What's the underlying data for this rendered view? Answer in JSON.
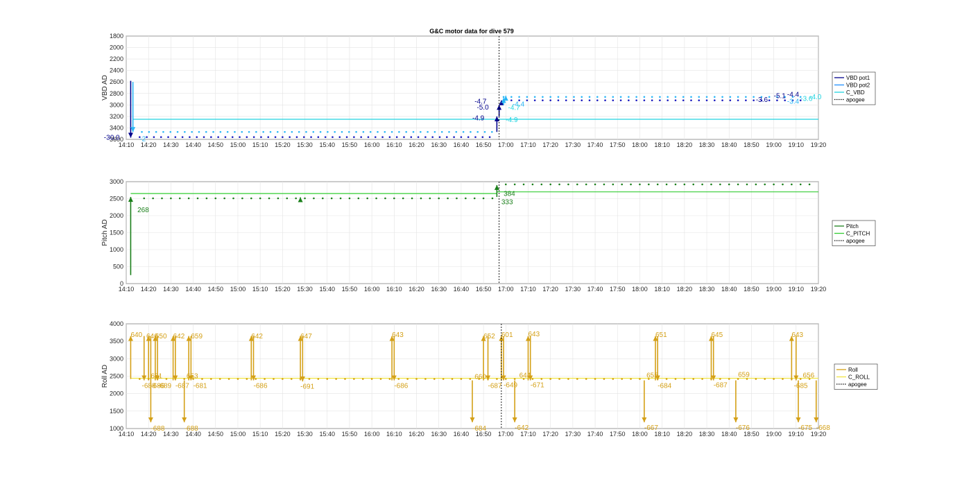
{
  "title": "G&C motor data for dive 579",
  "time_ticks": [
    "14:10",
    "14:20",
    "14:30",
    "14:40",
    "14:50",
    "15:00",
    "15:10",
    "15:20",
    "15:30",
    "15:40",
    "15:50",
    "16:00",
    "16:10",
    "16:20",
    "16:30",
    "16:40",
    "16:50",
    "17:00",
    "17:10",
    "17:20",
    "17:30",
    "17:40",
    "17:50",
    "18:00",
    "18:10",
    "18:20",
    "18:30",
    "18:40",
    "18:50",
    "19:00",
    "19:10",
    "19:20"
  ],
  "chart_data": [
    {
      "type": "scatter",
      "name": "vbd",
      "ylabel": "VBD AD",
      "xlim": [
        0,
        310
      ],
      "ylim": [
        3600,
        1800
      ],
      "y_reversed": true,
      "yticks": [
        1800,
        2000,
        2200,
        2400,
        2600,
        2800,
        3000,
        3200,
        3400,
        3600
      ],
      "apogee_x": 167,
      "legend": {
        "placement": "right",
        "entries": [
          {
            "label": "VBD pot1",
            "color": "#00008b",
            "style": "line"
          },
          {
            "label": "VBD pot2",
            "color": "#1e90ff",
            "style": "line"
          },
          {
            "label": "C_VBD",
            "color": "#20d4e0",
            "style": "line"
          },
          {
            "label": "apogee",
            "color": "#000000",
            "style": "dotted"
          }
        ]
      },
      "command_segments": [
        {
          "x0": 3,
          "x1": 310,
          "y": 3250,
          "color": "#20d4e0"
        }
      ],
      "dot_series": [
        {
          "color": "#1f1fbf",
          "x_start": 6,
          "x_end": 165,
          "step": 3.2,
          "y": 3560
        },
        {
          "color": "#29b6f6",
          "x_start": 7,
          "x_end": 165,
          "step": 3.2,
          "y": 3470
        },
        {
          "color": "#1f1fbf",
          "x_start": 169,
          "x_end": 305,
          "step": 3.5,
          "y": 2920
        },
        {
          "color": "#29b6f6",
          "x_start": 169,
          "x_end": 305,
          "step": 3.5,
          "y": 2860
        }
      ],
      "moves": [
        {
          "x": 2,
          "from": 2580,
          "to": 3570,
          "color": "#00008b"
        },
        {
          "x": 3,
          "from": 2600,
          "to": 3470,
          "color": "#29b6f6"
        },
        {
          "x": 166,
          "from": 3470,
          "to": 3200,
          "color": "#00008b"
        },
        {
          "x": 167,
          "from": 3200,
          "to": 3000,
          "color": "#00008b"
        },
        {
          "x": 168,
          "from": 3000,
          "to": 2920,
          "color": "#00008b"
        },
        {
          "x": 169,
          "from": 3000,
          "to": 2880,
          "color": "#29b6f6"
        },
        {
          "x": 170,
          "from": 2880,
          "to": 2840,
          "color": "#29b6f6"
        }
      ],
      "labels": [
        {
          "x": -10,
          "y": 3560,
          "text": "-30.0",
          "color": "#00008b"
        },
        {
          "x": 6,
          "y": 3580,
          "text": "-2",
          "color": "#29b6f6"
        },
        {
          "x": 156,
          "y": 2930,
          "text": "-4.7",
          "color": "#00008b"
        },
        {
          "x": 157,
          "y": 3030,
          "text": "-5.0",
          "color": "#00008b"
        },
        {
          "x": 155,
          "y": 3220,
          "text": "-4.9",
          "color": "#00008b"
        },
        {
          "x": 173,
          "y": 2980,
          "text": "-4.4",
          "color": "#29b6f6"
        },
        {
          "x": 171,
          "y": 3040,
          "text": "-4.7",
          "color": "#20d4e0"
        },
        {
          "x": 170,
          "y": 3250,
          "text": "-4.9",
          "color": "#20d4e0"
        },
        {
          "x": 282,
          "y": 2900,
          "text": "-3.6",
          "color": "#00008b"
        },
        {
          "x": 290,
          "y": 2830,
          "text": "-5.1",
          "color": "#00008b"
        },
        {
          "x": 296,
          "y": 2810,
          "text": "-4.4",
          "color": "#00008b"
        },
        {
          "x": 296,
          "y": 2930,
          "text": "-3.4",
          "color": "#29b6f6"
        },
        {
          "x": 302,
          "y": 2880,
          "text": "-3.6",
          "color": "#20d4e0"
        },
        {
          "x": 306,
          "y": 2850,
          "text": "-4.0",
          "color": "#20d4e0"
        }
      ]
    },
    {
      "type": "scatter",
      "name": "pitch",
      "ylabel": "Pitch AD",
      "xlim": [
        0,
        310
      ],
      "ylim": [
        0,
        3000
      ],
      "yticks": [
        0,
        500,
        1000,
        1500,
        2000,
        2500,
        3000
      ],
      "apogee_x": 167,
      "legend": {
        "placement": "right",
        "entries": [
          {
            "label": "Pitch",
            "color": "#1a7f1a",
            "style": "line"
          },
          {
            "label": "C_PITCH",
            "color": "#32cd32",
            "style": "line"
          },
          {
            "label": "apogee",
            "color": "#000000",
            "style": "dotted"
          }
        ]
      },
      "command_segments": [
        {
          "x0": 2,
          "x1": 166,
          "y": 2650,
          "color": "#32cd32"
        },
        {
          "x0": 166,
          "x1": 310,
          "y": 2700,
          "color": "#32cd32"
        }
      ],
      "dot_series": [
        {
          "color": "#1a7f1a",
          "x_start": 8,
          "x_end": 165,
          "step": 4,
          "y": 2510
        },
        {
          "color": "#1a7f1a",
          "x_start": 170,
          "x_end": 308,
          "step": 4,
          "y": 2920
        }
      ],
      "moves": [
        {
          "x": 2,
          "from": 250,
          "to": 2550,
          "color": "#1a7f1a"
        },
        {
          "x": 78,
          "from": 2480,
          "to": 2540,
          "color": "#1a7f1a"
        },
        {
          "x": 166,
          "from": 2550,
          "to": 2900,
          "color": "#1a7f1a"
        }
      ],
      "labels": [
        {
          "x": 5,
          "y": 2180,
          "text": "268",
          "color": "#1a7f1a"
        },
        {
          "x": 169,
          "y": 2660,
          "text": "384",
          "color": "#1a7f1a"
        },
        {
          "x": 168,
          "y": 2420,
          "text": "333",
          "color": "#1a7f1a"
        }
      ]
    },
    {
      "type": "scatter",
      "name": "roll",
      "ylabel": "Roll AD",
      "xlim": [
        0,
        310
      ],
      "ylim": [
        1000,
        4000
      ],
      "yticks": [
        1000,
        1500,
        2000,
        2500,
        3000,
        3500,
        4000
      ],
      "apogee_x": 168,
      "legend": {
        "placement": "right",
        "entries": [
          {
            "label": "Roll",
            "color": "#d4a017",
            "style": "line"
          },
          {
            "label": "C_ROLL",
            "color": "#f0e442",
            "style": "line"
          },
          {
            "label": "apogee",
            "color": "#000000",
            "style": "dotted"
          }
        ]
      },
      "command_segments": [
        {
          "x0": 2,
          "x1": 310,
          "y": 2440,
          "color": "#f0e442"
        }
      ],
      "dot_series": [
        {
          "color": "#d4a017",
          "x_start": 6,
          "x_end": 308,
          "step": 4,
          "y": 2420
        }
      ],
      "moves": [
        {
          "x": 2,
          "from": 2420,
          "to": 3650,
          "color": "#d4a017"
        },
        {
          "x": 8,
          "from": 3650,
          "to": 2380,
          "color": "#d4a017"
        },
        {
          "x": 10,
          "from": 2380,
          "to": 3650,
          "color": "#d4a017"
        },
        {
          "x": 11,
          "from": 3650,
          "to": 1180,
          "color": "#d4a017"
        },
        {
          "x": 13,
          "from": 2380,
          "to": 3650,
          "color": "#d4a017"
        },
        {
          "x": 14,
          "from": 3650,
          "to": 2380,
          "color": "#d4a017"
        },
        {
          "x": 21,
          "from": 2380,
          "to": 3650,
          "color": "#d4a017"
        },
        {
          "x": 22,
          "from": 3650,
          "to": 2380,
          "color": "#d4a017"
        },
        {
          "x": 26,
          "from": 2380,
          "to": 1180,
          "color": "#d4a017"
        },
        {
          "x": 28,
          "from": 2380,
          "to": 3650,
          "color": "#d4a017"
        },
        {
          "x": 29,
          "from": 3650,
          "to": 2380,
          "color": "#d4a017"
        },
        {
          "x": 56,
          "from": 2380,
          "to": 3650,
          "color": "#d4a017"
        },
        {
          "x": 57,
          "from": 3650,
          "to": 2380,
          "color": "#d4a017"
        },
        {
          "x": 78,
          "from": 2380,
          "to": 3650,
          "color": "#d4a017"
        },
        {
          "x": 79,
          "from": 3650,
          "to": 2350,
          "color": "#d4a017"
        },
        {
          "x": 119,
          "from": 2380,
          "to": 3650,
          "color": "#d4a017"
        },
        {
          "x": 120,
          "from": 3650,
          "to": 2380,
          "color": "#d4a017"
        },
        {
          "x": 155,
          "from": 2380,
          "to": 1180,
          "color": "#d4a017"
        },
        {
          "x": 160,
          "from": 2380,
          "to": 3650,
          "color": "#d4a017"
        },
        {
          "x": 162,
          "from": 3650,
          "to": 2380,
          "color": "#d4a017"
        },
        {
          "x": 168,
          "from": 2380,
          "to": 3650,
          "color": "#d4a017"
        },
        {
          "x": 169,
          "from": 3650,
          "to": 2380,
          "color": "#d4a017"
        },
        {
          "x": 174,
          "from": 2380,
          "to": 1180,
          "color": "#d4a017"
        },
        {
          "x": 180,
          "from": 2380,
          "to": 3650,
          "color": "#d4a017"
        },
        {
          "x": 181,
          "from": 3650,
          "to": 2380,
          "color": "#d4a017"
        },
        {
          "x": 232,
          "from": 2380,
          "to": 1180,
          "color": "#d4a017"
        },
        {
          "x": 237,
          "from": 2380,
          "to": 3650,
          "color": "#d4a017"
        },
        {
          "x": 238,
          "from": 3650,
          "to": 2380,
          "color": "#d4a017"
        },
        {
          "x": 262,
          "from": 2380,
          "to": 3650,
          "color": "#d4a017"
        },
        {
          "x": 263,
          "from": 3650,
          "to": 2380,
          "color": "#d4a017"
        },
        {
          "x": 273,
          "from": 2380,
          "to": 1180,
          "color": "#d4a017"
        },
        {
          "x": 298,
          "from": 2380,
          "to": 3650,
          "color": "#d4a017"
        },
        {
          "x": 300,
          "from": 3650,
          "to": 2380,
          "color": "#d4a017"
        },
        {
          "x": 301,
          "from": 2380,
          "to": 1180,
          "color": "#d4a017"
        },
        {
          "x": 309,
          "from": 2380,
          "to": 1180,
          "color": "#d4a017"
        }
      ],
      "labels": [
        {
          "x": 2,
          "y": 3700,
          "text": "640",
          "color": "#d4a017"
        },
        {
          "x": 9,
          "y": 3660,
          "text": "646",
          "color": "#d4a017"
        },
        {
          "x": 13,
          "y": 3660,
          "text": "650",
          "color": "#d4a017"
        },
        {
          "x": 21,
          "y": 3660,
          "text": "642",
          "color": "#d4a017"
        },
        {
          "x": 29,
          "y": 3660,
          "text": "659",
          "color": "#d4a017"
        },
        {
          "x": 56,
          "y": 3660,
          "text": "642",
          "color": "#d4a017"
        },
        {
          "x": 78,
          "y": 3660,
          "text": "647",
          "color": "#d4a017"
        },
        {
          "x": 119,
          "y": 3700,
          "text": "643",
          "color": "#d4a017"
        },
        {
          "x": 160,
          "y": 3660,
          "text": "652",
          "color": "#d4a017"
        },
        {
          "x": 168,
          "y": 3700,
          "text": "601",
          "color": "#d4a017"
        },
        {
          "x": 180,
          "y": 3720,
          "text": "643",
          "color": "#d4a017"
        },
        {
          "x": 237,
          "y": 3700,
          "text": "651",
          "color": "#d4a017"
        },
        {
          "x": 262,
          "y": 3700,
          "text": "645",
          "color": "#d4a017"
        },
        {
          "x": 298,
          "y": 3700,
          "text": "643",
          "color": "#d4a017"
        },
        {
          "x": 11,
          "y": 2520,
          "text": "651",
          "color": "#d4a017"
        },
        {
          "x": 27,
          "y": 2520,
          "text": "653",
          "color": "#d4a017"
        },
        {
          "x": 156,
          "y": 2500,
          "text": "660",
          "color": "#d4a017"
        },
        {
          "x": 176,
          "y": 2540,
          "text": "644",
          "color": "#d4a017"
        },
        {
          "x": 233,
          "y": 2540,
          "text": "655",
          "color": "#d4a017"
        },
        {
          "x": 274,
          "y": 2560,
          "text": "659",
          "color": "#d4a017"
        },
        {
          "x": 303,
          "y": 2540,
          "text": "656",
          "color": "#d4a017"
        },
        {
          "x": 7,
          "y": 2240,
          "text": "-688",
          "color": "#d4a017"
        },
        {
          "x": 11,
          "y": 2240,
          "text": "-686",
          "color": "#d4a017"
        },
        {
          "x": 14,
          "y": 2240,
          "text": "-689",
          "color": "#d4a017"
        },
        {
          "x": 22,
          "y": 2240,
          "text": "-687",
          "color": "#d4a017"
        },
        {
          "x": 30,
          "y": 2240,
          "text": "-681",
          "color": "#d4a017"
        },
        {
          "x": 57,
          "y": 2240,
          "text": "-686",
          "color": "#d4a017"
        },
        {
          "x": 78,
          "y": 2220,
          "text": "-691",
          "color": "#d4a017"
        },
        {
          "x": 120,
          "y": 2240,
          "text": "-686",
          "color": "#d4a017"
        },
        {
          "x": 162,
          "y": 2240,
          "text": "-687",
          "color": "#d4a017"
        },
        {
          "x": 169,
          "y": 2260,
          "text": "-649",
          "color": "#d4a017"
        },
        {
          "x": 181,
          "y": 2260,
          "text": "-671",
          "color": "#d4a017"
        },
        {
          "x": 238,
          "y": 2240,
          "text": "-684",
          "color": "#d4a017"
        },
        {
          "x": 263,
          "y": 2260,
          "text": "-687",
          "color": "#d4a017"
        },
        {
          "x": 299,
          "y": 2240,
          "text": "-685",
          "color": "#d4a017"
        },
        {
          "x": 11,
          "y": 1020,
          "text": "-688",
          "color": "#d4a017"
        },
        {
          "x": 26,
          "y": 1020,
          "text": "-688",
          "color": "#d4a017"
        },
        {
          "x": 155,
          "y": 1020,
          "text": "-684",
          "color": "#d4a017"
        },
        {
          "x": 174,
          "y": 1040,
          "text": "-642",
          "color": "#d4a017"
        },
        {
          "x": 232,
          "y": 1040,
          "text": "-667",
          "color": "#d4a017"
        },
        {
          "x": 273,
          "y": 1040,
          "text": "-676",
          "color": "#d4a017"
        },
        {
          "x": 301,
          "y": 1040,
          "text": "-675",
          "color": "#d4a017"
        },
        {
          "x": 309,
          "y": 1040,
          "text": "-668",
          "color": "#d4a017"
        }
      ]
    }
  ]
}
